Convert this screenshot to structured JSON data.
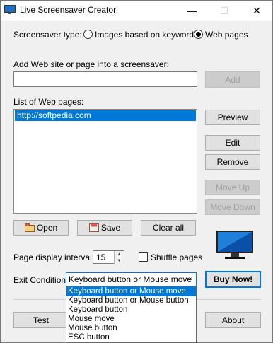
{
  "window": {
    "title": "Live Screensaver Creator",
    "minimize_icon": "minimize-icon",
    "maximize_icon": "maximize-icon",
    "close_icon": "close-icon"
  },
  "screensaver_type": {
    "label": "Screensaver type:",
    "options": [
      {
        "label": "Images based on keywords",
        "selected": false
      },
      {
        "label": "Web pages",
        "selected": true
      }
    ]
  },
  "add_site": {
    "label": "Add Web site or page into a screensaver:",
    "value": "",
    "add_button": "Add"
  },
  "web_pages": {
    "label": "List of Web pages:",
    "items": [
      "http://softpedia.com"
    ],
    "preview_button": "Preview",
    "edit_button": "Edit",
    "remove_button": "Remove",
    "move_up_button": "Move Up",
    "move_down_button": "Move Down"
  },
  "file_actions": {
    "open_button": "Open",
    "save_button": "Save",
    "clear_button": "Clear all"
  },
  "interval": {
    "label": "Page display interval:",
    "value": "15",
    "shuffle_label": "Shuffle pages",
    "shuffle_checked": false
  },
  "exit_condition": {
    "label": "Exit Condition:",
    "selected": "Keyboard button or Mouse move",
    "options": [
      "Keyboard button or Mouse move",
      "Keyboard button or Mouse button",
      "Keyboard button",
      "Mouse move",
      "Mouse button",
      "ESC button"
    ]
  },
  "buy_button": "Buy Now!",
  "bottom": {
    "test_button": "Test",
    "about_button": "About"
  },
  "colors": {
    "accent": "#0078d7",
    "background": "#f0f0f0"
  }
}
